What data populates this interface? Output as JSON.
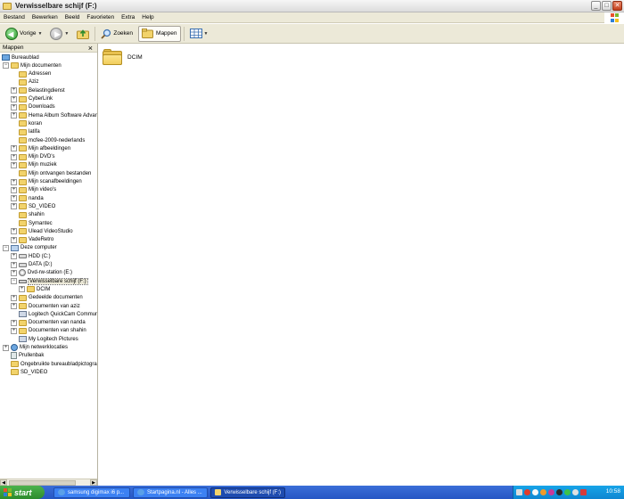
{
  "window": {
    "title": "Verwisselbare schijf (F:)",
    "controls": {
      "minimize": "_",
      "maximize": "□",
      "close": "✕"
    }
  },
  "menu": [
    "Bestand",
    "Bewerken",
    "Beeld",
    "Favorieten",
    "Extra",
    "Help"
  ],
  "toolbar": {
    "back_label": "Vorige",
    "search_label": "Zoeken",
    "folders_label": "Mappen",
    "dropdown_glyph": "▼"
  },
  "sidebar": {
    "title": "Mappen",
    "close_glyph": "×",
    "tree": [
      {
        "label": "Bureaublad",
        "icon": "desktop-icon",
        "expander": "",
        "level": 0
      },
      {
        "label": "Mijn documenten",
        "icon": "folder-icon",
        "expander": "−",
        "level": 1
      },
      {
        "label": "Adressen",
        "icon": "folder-icon",
        "expander": "",
        "level": 2
      },
      {
        "label": "Aziz",
        "icon": "folder-icon",
        "expander": "",
        "level": 2
      },
      {
        "label": "Belastingdienst",
        "icon": "folder-icon",
        "expander": "+",
        "level": 2
      },
      {
        "label": "CyberLink",
        "icon": "folder-icon",
        "expander": "+",
        "level": 2
      },
      {
        "label": "Downloads",
        "icon": "folder-icon",
        "expander": "+",
        "level": 2
      },
      {
        "label": "Hema Album Software Advar",
        "icon": "folder-icon",
        "expander": "+",
        "level": 2
      },
      {
        "label": "koran",
        "icon": "folder-icon",
        "expander": "",
        "level": 2
      },
      {
        "label": "latifa",
        "icon": "folder-icon",
        "expander": "",
        "level": 2
      },
      {
        "label": "mcfee-2009-nederlands",
        "icon": "folder-icon",
        "expander": "",
        "level": 2
      },
      {
        "label": "Mijn afbeeldingen",
        "icon": "folder-icon",
        "expander": "+",
        "level": 2
      },
      {
        "label": "Mijn DVD's",
        "icon": "folder-icon",
        "expander": "+",
        "level": 2
      },
      {
        "label": "Mijn muziek",
        "icon": "folder-icon",
        "expander": "+",
        "level": 2
      },
      {
        "label": "Mijn ontvangen bestanden",
        "icon": "folder-icon",
        "expander": "",
        "level": 2
      },
      {
        "label": "Mijn scanafbeeldingen",
        "icon": "folder-icon",
        "expander": "+",
        "level": 2
      },
      {
        "label": "Mijn video's",
        "icon": "folder-icon",
        "expander": "+",
        "level": 2
      },
      {
        "label": "nanda",
        "icon": "folder-icon",
        "expander": "+",
        "level": 2
      },
      {
        "label": "SD_VIDEO",
        "icon": "folder-icon",
        "expander": "+",
        "level": 2
      },
      {
        "label": "shahin",
        "icon": "folder-icon",
        "expander": "",
        "level": 2
      },
      {
        "label": "Symantec",
        "icon": "folder-icon",
        "expander": "",
        "level": 2
      },
      {
        "label": "Ulead VideoStudio",
        "icon": "folder-icon",
        "expander": "+",
        "level": 2
      },
      {
        "label": "VadeRetro",
        "icon": "folder-icon",
        "expander": "+",
        "level": 2
      },
      {
        "label": "Deze computer",
        "icon": "computer-icon",
        "expander": "−",
        "level": 1
      },
      {
        "label": "HDD (C:)",
        "icon": "hard-drive-icon",
        "expander": "+",
        "level": 2
      },
      {
        "label": "DATA (D:)",
        "icon": "hard-drive-icon",
        "expander": "+",
        "level": 2
      },
      {
        "label": "Dvd-rw-station (E:)",
        "icon": "cdrom-icon",
        "expander": "+",
        "level": 2
      },
      {
        "label": "Verwisselbare schijf (F:)",
        "icon": "removable-drive-icon",
        "expander": "−",
        "level": 2,
        "selected": true
      },
      {
        "label": "DCIM",
        "icon": "folder-icon",
        "expander": "+",
        "level": 3
      },
      {
        "label": "Gedeelde documenten",
        "icon": "folder-icon",
        "expander": "+",
        "level": 2
      },
      {
        "label": "Documenten van aziz",
        "icon": "folder-icon",
        "expander": "+",
        "level": 2
      },
      {
        "label": "Logitech QuickCam Communi",
        "icon": "program-icon",
        "expander": "",
        "level": 2
      },
      {
        "label": "Documenten van nanda",
        "icon": "folder-icon",
        "expander": "+",
        "level": 2
      },
      {
        "label": "Documenten van shahin",
        "icon": "folder-icon",
        "expander": "+",
        "level": 2
      },
      {
        "label": "My Logitech Pictures",
        "icon": "program-icon",
        "expander": "",
        "level": 2
      },
      {
        "label": "Mijn netwerklocaties",
        "icon": "network-icon",
        "expander": "+",
        "level": 1
      },
      {
        "label": "Prullenbak",
        "icon": "recycle-bin-icon",
        "expander": "",
        "level": 1
      },
      {
        "label": "Ongebruikte bureaubladpictogran",
        "icon": "folder-icon",
        "expander": "",
        "level": 1
      },
      {
        "label": "SD_VIDEO",
        "icon": "folder-icon",
        "expander": "",
        "level": 1
      }
    ]
  },
  "content": {
    "items": [
      {
        "name": "DCIM",
        "icon": "folder-icon"
      }
    ]
  },
  "taskbar": {
    "start_label": "start",
    "tasks": [
      {
        "label": "samsung digimax i6 p...",
        "icon": "ie-icon",
        "active": false
      },
      {
        "label": "Startpagina.nl - Alles ...",
        "icon": "ie-icon",
        "active": false
      },
      {
        "label": "Verwisselbare schijf (F:)",
        "icon": "folder-icon",
        "active": true
      }
    ],
    "clock": "10:58"
  },
  "colors": {
    "taskbar_blue": "#2556c4",
    "start_green": "#2d8b2d",
    "folder_yellow": "#f2d36b",
    "tray_blue": "#0f86d1"
  }
}
